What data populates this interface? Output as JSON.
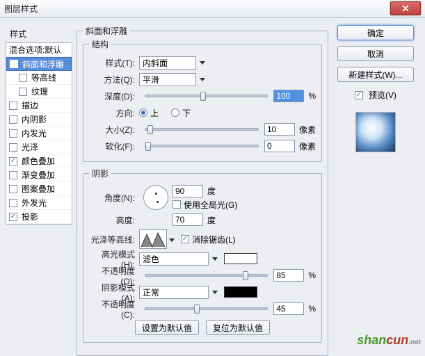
{
  "window": {
    "title": "图层样式",
    "close_icon": "close"
  },
  "left": {
    "header": "样式",
    "blending": "混合选项:默认",
    "items": [
      {
        "label": "斜面和浮雕",
        "checked": true,
        "selected": true
      },
      {
        "label": "等高线",
        "checked": false,
        "sub": true
      },
      {
        "label": "纹理",
        "checked": false,
        "sub": true
      },
      {
        "label": "描边",
        "checked": false
      },
      {
        "label": "内阴影",
        "checked": false
      },
      {
        "label": "内发光",
        "checked": false
      },
      {
        "label": "光泽",
        "checked": false
      },
      {
        "label": "颜色叠加",
        "checked": true
      },
      {
        "label": "渐变叠加",
        "checked": false
      },
      {
        "label": "图案叠加",
        "checked": false
      },
      {
        "label": "外发光",
        "checked": false
      },
      {
        "label": "投影",
        "checked": true
      }
    ]
  },
  "bevel": {
    "group": "斜面和浮雕",
    "struct_group": "结构",
    "style_label": "样式(T):",
    "style_value": "内斜面",
    "tech_label": "方法(Q):",
    "tech_value": "平滑",
    "depth_label": "深度(D):",
    "depth_value": "100",
    "depth_unit": "%",
    "dir_label": "方向:",
    "dir_up": "上",
    "dir_down": "下",
    "size_label": "大小(Z):",
    "size_value": "10",
    "size_unit": "像素",
    "soften_label": "软化(F):",
    "soften_value": "0",
    "soften_unit": "像素",
    "shadow_group": "阴影",
    "angle_label": "角度(N):",
    "angle_value": "90",
    "angle_unit": "度",
    "global_label": "使用全局光(G)",
    "alt_label": "高度:",
    "alt_value": "70",
    "alt_unit": "度",
    "gloss_label": "光泽等高线:",
    "aa_label": "消除锯齿(L)",
    "hl_mode_label": "高光模式(H):",
    "hl_mode_value": "滤色",
    "hl_color": "#ffffff",
    "hl_op_label": "不透明度(O):",
    "hl_op_value": "85",
    "hl_op_unit": "%",
    "sh_mode_label": "阴影模式(A):",
    "sh_mode_value": "正常",
    "sh_color": "#000000",
    "sh_op_label": "不透明度(C):",
    "sh_op_value": "45",
    "sh_op_unit": "%",
    "make_default": "设置为默认值",
    "reset_default": "复位为默认值"
  },
  "right": {
    "ok": "确定",
    "cancel": "取消",
    "new_style": "新建样式(W)...",
    "preview_label": "预览(V)"
  },
  "slider_positions": {
    "depth": 45,
    "size": 2,
    "soften": 0,
    "hl_op": 80,
    "sh_op": 40
  },
  "watermark": {
    "a": "shan",
    "b": "cun",
    "c": ".net"
  }
}
